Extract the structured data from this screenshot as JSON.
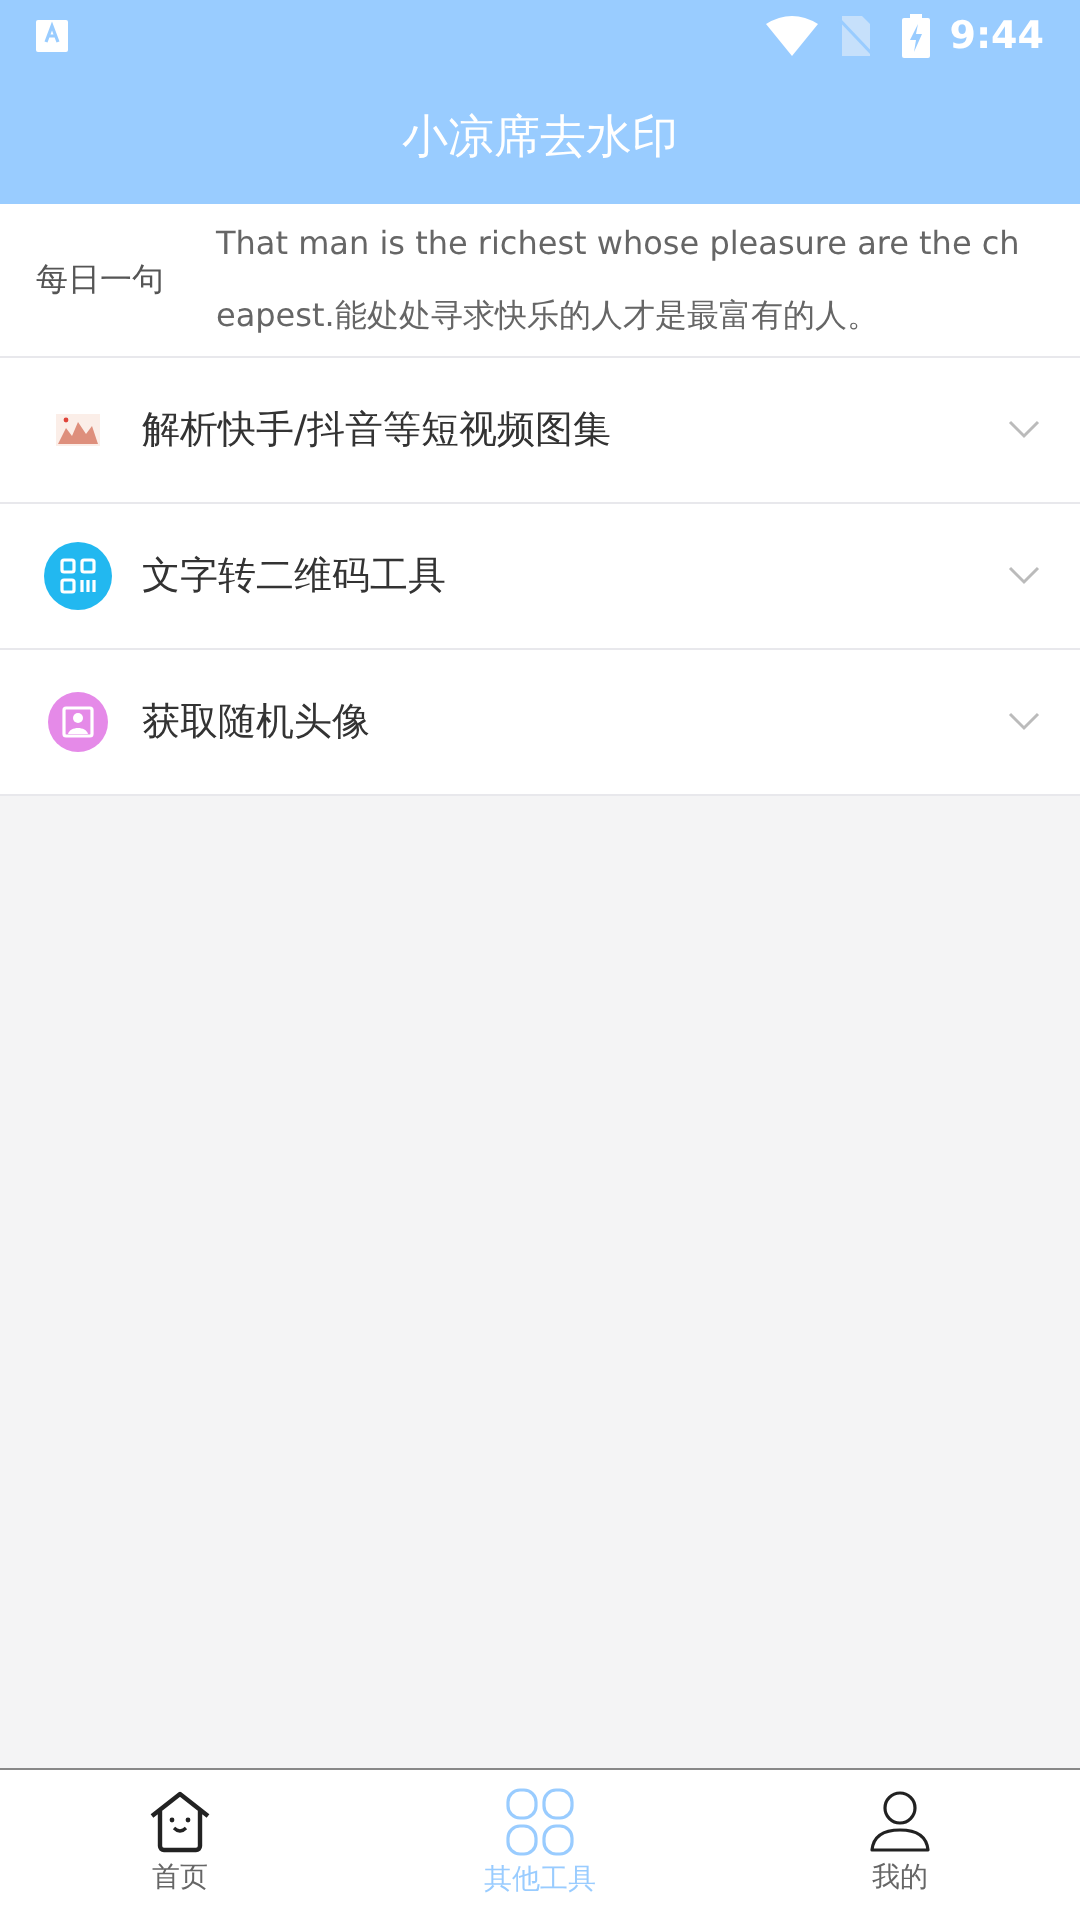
{
  "status_bar": {
    "time": "9:44"
  },
  "header": {
    "title": "小凉席去水印"
  },
  "daily_quote": {
    "label": "每日一句",
    "text": "That man is the richest whose pleasure are the cheapest.能处处寻求快乐的人才是最富有的人。"
  },
  "tools": [
    {
      "kind": "gallery",
      "label": "解析快手/抖音等短视频图集",
      "expanded": false
    },
    {
      "kind": "qrcode",
      "label": "文字转二维码工具",
      "expanded": false
    },
    {
      "kind": "avatar",
      "label": "获取随机头像",
      "expanded": false
    }
  ],
  "tab_bar": [
    {
      "kind": "home",
      "label": "首页",
      "selected": false
    },
    {
      "kind": "tools",
      "label": "其他工具",
      "selected": true
    },
    {
      "kind": "profile",
      "label": "我的",
      "selected": false
    }
  ]
}
